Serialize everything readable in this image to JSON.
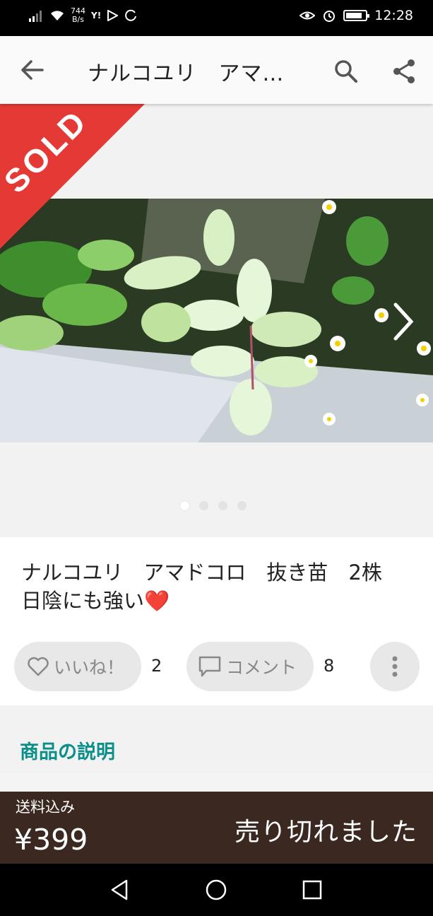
{
  "status_bar": {
    "net_speed_value": "744",
    "net_speed_unit": "B/s",
    "time": "12:28",
    "battery_level": 0.85,
    "icons": [
      "signal-icon",
      "wifi-icon",
      "yahoo-icon",
      "play-store-icon",
      "sync-icon",
      "eye-comfort-icon",
      "alarm-icon",
      "battery-icon"
    ]
  },
  "app_bar": {
    "title": "ナルコユリ　アマドコロ　抜き苗　2株　日陰にも強い",
    "icons": [
      "back-arrow-icon",
      "search-icon",
      "share-icon"
    ]
  },
  "gallery": {
    "ribbon": "SOLD",
    "ribbon_color": "#e53935",
    "current_image": 1,
    "image_count": 4
  },
  "item": {
    "title": "ナルコユリ　アマドコロ　抜き苗　2株　日陰にも強い❤️",
    "like_label": "いいね！",
    "like_count": "2",
    "comment_label": "コメント",
    "comment_count": "8"
  },
  "description": {
    "heading": "商品の説明",
    "heading_color": "#0c8f8a"
  },
  "purchase_bar": {
    "shipping_label": "送料込み",
    "price": "¥399",
    "status": "売り切れました",
    "background": "#3b2820"
  },
  "nav_bar": {
    "icons": [
      "back-triangle-icon",
      "home-circle-icon",
      "recents-square-icon"
    ]
  }
}
